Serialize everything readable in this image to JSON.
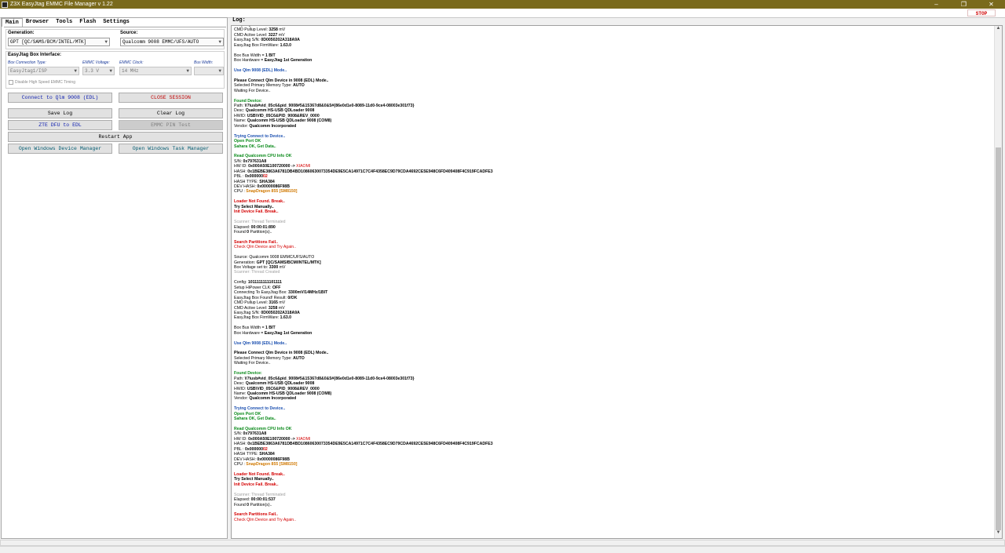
{
  "window": {
    "title": "Z3X EasyJtag EMMC File Manager v 1.22",
    "minimize": "–",
    "maximize": "❐",
    "close": "✕"
  },
  "toolbar": {
    "stop_label": "STOP"
  },
  "tabs": [
    {
      "label": "Main",
      "active": true
    },
    {
      "label": "Browser"
    },
    {
      "label": "Tools"
    },
    {
      "label": "Flash"
    },
    {
      "label": "Settings"
    }
  ],
  "main": {
    "generation_label": "Generation:",
    "generation_value": "GPT [QC/SAMS/BCM/INTEL/MTK]",
    "source_label": "Source:",
    "source_value": "Qualcomm 9008 EMMC/UFS/AUTO",
    "box_interface_label": "EasyJtag Box Interface:",
    "box_conn_type_label": "Box Connection Type:",
    "box_conn_type_value": "EasyJtag1/ISP",
    "emmc_voltage_label": "EMMC Voltage:",
    "emmc_voltage_value": "3.3 V",
    "emmc_clock_label": "EMMC Clock:",
    "emmc_clock_value": "14 MHz",
    "bus_width_label": "Bus Width:",
    "bus_width_value": "",
    "hs_timing_label": "Disable High Speed EMMC Timing",
    "buttons": {
      "connect": "Connect to Qlm 9008 (EDL)",
      "close_session": "CLOSE SESSION",
      "save_log": "Save Log",
      "clear_log": "Clear Log",
      "zte_dfu": "ZTE DFU to EDL",
      "emmc_pin_test": "EMMC PIN Test",
      "restart_app": "Restart App",
      "device_manager": "Open Windows Device Manager",
      "task_manager": "Open Windows Task Manager"
    }
  },
  "log": {
    "label": "Log:",
    "colors": {
      "black": "#000000",
      "blue": "#1a4fb0",
      "green": "#0a8a1a",
      "red": "#d40000",
      "orange": "#d07800",
      "gray": "#a0a0a0",
      "darkred": "#b00000"
    },
    "lines": [
      {
        "segs": [
          {
            "t": "EasyJtag Box Found! Result: "
          },
          {
            "t": "0/OK",
            "b": true
          }
        ],
        "c": "black"
      },
      {
        "segs": [
          {
            "t": " CMD Pullup Level: "
          },
          {
            "t": "3258",
            "b": true
          },
          {
            "t": " mV"
          }
        ],
        "c": "black"
      },
      {
        "segs": [
          {
            "t": " CMD Active Level: "
          },
          {
            "t": "3227",
            "b": true
          },
          {
            "t": " mV"
          }
        ],
        "c": "black"
      },
      {
        "segs": [
          {
            "t": "EasyJtag S/N: "
          },
          {
            "t": "0D0050202A318A9A",
            "b": true
          }
        ],
        "c": "black"
      },
      {
        "segs": [
          {
            "t": "EasyJtag Box FirmWare: "
          },
          {
            "t": "1.63.0",
            "b": true
          }
        ],
        "c": "black"
      },
      {
        "blank": true
      },
      {
        "segs": [
          {
            "t": "Box Bus Width = "
          },
          {
            "t": "1 BIT",
            "b": true
          }
        ],
        "c": "black"
      },
      {
        "segs": [
          {
            "t": "Box Hardware  = "
          },
          {
            "t": "EasyJtag 1st Generation",
            "b": true
          }
        ],
        "c": "black"
      },
      {
        "blank": true
      },
      {
        "segs": [
          {
            "t": "Use Qlm 9008 (EDL) Mode..",
            "b": true
          }
        ],
        "c": "blue"
      },
      {
        "blank": true
      },
      {
        "segs": [
          {
            "t": "Please Connect Qlm Device in 9008 (EDL) Mode..",
            "b": true
          }
        ],
        "c": "black"
      },
      {
        "segs": [
          {
            "t": " Selected Primary Memory Type: "
          },
          {
            "t": "AUTO",
            "b": true
          }
        ],
        "c": "black"
      },
      {
        "segs": [
          {
            "t": "Waiting For Device.."
          }
        ],
        "c": "black"
      },
      {
        "blank": true
      },
      {
        "segs": [
          {
            "t": "Found Device:",
            "b": true
          }
        ],
        "c": "green"
      },
      {
        "segs": [
          {
            "t": " Path: "
          },
          {
            "t": "\\\\?\\usb#vid_05c6&pid_9008#5&15367d8&0&5#{86e0d1e0-8089-11d0-9ce4-08003e301f73}",
            "b": true
          }
        ],
        "c": "black"
      },
      {
        "segs": [
          {
            "t": " Desc: "
          },
          {
            "t": "Qualcomm HS-USB QDLoader 9008",
            "b": true
          }
        ],
        "c": "black"
      },
      {
        "segs": [
          {
            "t": " HWID: "
          },
          {
            "t": "USB\\VID_05C6&PID_9008&REV_0000",
            "b": true
          }
        ],
        "c": "black"
      },
      {
        "segs": [
          {
            "t": " Name: "
          },
          {
            "t": "Qualcomm HS-USB QDLoader 9008 (COM8)",
            "b": true
          }
        ],
        "c": "black"
      },
      {
        "segs": [
          {
            "t": " Vendor: "
          },
          {
            "t": "Qualcomm Incorporated",
            "b": true
          }
        ],
        "c": "black"
      },
      {
        "blank": true
      },
      {
        "segs": [
          {
            "t": "Trying Connect to Device..",
            "b": true
          }
        ],
        "c": "blue"
      },
      {
        "segs": [
          {
            "t": "Open Port OK",
            "b": true
          }
        ],
        "c": "green"
      },
      {
        "segs": [
          {
            "t": "Sahara OK, Get Data..",
            "b": true
          }
        ],
        "c": "green"
      },
      {
        "blank": true
      },
      {
        "segs": [
          {
            "t": "Read Qualcomm CPU Info OK",
            "b": true
          }
        ],
        "c": "green"
      },
      {
        "segs": [
          {
            "t": " S/N: "
          },
          {
            "t": "0x797631A8",
            "b": true
          }
        ],
        "c": "black"
      },
      {
        "segs": [
          {
            "t": " HW ID: "
          },
          {
            "t": "0x000A50E100720000 -> ",
            "b": true
          },
          {
            "t": "XIAOMI",
            "c": "red"
          }
        ],
        "c": "black"
      },
      {
        "segs": [
          {
            "t": " HASH: "
          },
          {
            "t": "0x1BEBE3863A6781DB4BD10860630073354DE9E5CA14971C7C4F4358EC9D79CDA4692CE5E948C6FD409408F4C919FCADFE3",
            "b": true
          }
        ],
        "c": "black"
      },
      {
        "segs": [
          {
            "t": " PBL : "
          },
          {
            "t": "0x000000",
            "b": true
          },
          {
            "t": "02",
            "b": true,
            "c": "red"
          }
        ],
        "c": "black"
      },
      {
        "segs": [
          {
            "t": " HASH TYPE: "
          },
          {
            "t": "SHA384",
            "b": true
          }
        ],
        "c": "black"
      },
      {
        "segs": [
          {
            "t": " DEV HASH: "
          },
          {
            "t": "0x00000086F98B",
            "b": true
          }
        ],
        "c": "black"
      },
      {
        "segs": [
          {
            "t": " CPU : "
          },
          {
            "t": "SnapDragon 855 [SM8150]",
            "b": true,
            "c": "orange"
          }
        ],
        "c": "black"
      },
      {
        "blank": true
      },
      {
        "segs": [
          {
            "t": "Loader Not Found. Break..",
            "b": true
          }
        ],
        "c": "red"
      },
      {
        "segs": [
          {
            "t": "Try Select Manually..",
            "b": true
          }
        ],
        "c": "black"
      },
      {
        "segs": [
          {
            "t": "Init Device Fail. Break..",
            "b": true
          }
        ],
        "c": "red"
      },
      {
        "blank": true
      },
      {
        "segs": [
          {
            "t": "Scanner: Thread Terminated"
          }
        ],
        "c": "gray"
      },
      {
        "segs": [
          {
            "t": "Elapsed: "
          },
          {
            "t": "00:00:01:890",
            "b": true
          }
        ],
        "c": "black"
      },
      {
        "segs": [
          {
            "t": "Found "
          },
          {
            "t": "0",
            "b": true
          },
          {
            "t": " Partition(s).."
          }
        ],
        "c": "black"
      },
      {
        "blank": true
      },
      {
        "segs": [
          {
            "t": "Search Partitions Fail..",
            "b": true
          }
        ],
        "c": "red"
      },
      {
        "segs": [
          {
            "t": "Check Qlm Device and Try Again.."
          }
        ],
        "c": "red"
      },
      {
        "blank": true
      },
      {
        "segs": [
          {
            "t": "Source: Qualcomm 9008 EMMC/UFS/AUTO"
          }
        ],
        "c": "black"
      },
      {
        "segs": [
          {
            "t": "Generation: "
          },
          {
            "t": "GPT [QC/SAMS/BCM/INTEL/MTK]",
            "b": true
          }
        ],
        "c": "black"
      },
      {
        "segs": [
          {
            "t": "Box Voltage set to: "
          },
          {
            "t": "3300",
            "b": true
          },
          {
            "t": " mV"
          }
        ],
        "c": "black"
      },
      {
        "segs": [
          {
            "t": "Scanner: Thread Created"
          }
        ],
        "c": "gray"
      },
      {
        "blank": true
      },
      {
        "segs": [
          {
            "t": "Config: "
          },
          {
            "t": "1011111111101111",
            "b": true
          }
        ],
        "c": "black"
      },
      {
        "segs": [
          {
            "t": "Setup HiPower CLK: "
          },
          {
            "t": "OFF",
            "b": true
          }
        ],
        "c": "black"
      },
      {
        "segs": [
          {
            "t": "Connecting To EasyJtag Box: "
          },
          {
            "t": "3300mV/14MHz/1BIT",
            "b": true
          }
        ],
        "c": "black"
      },
      {
        "segs": [
          {
            "t": "EasyJtag Box Found! Result: "
          },
          {
            "t": "0/OK",
            "b": true
          }
        ],
        "c": "black"
      },
      {
        "segs": [
          {
            "t": " CMD Pullup Level: "
          },
          {
            "t": "3165",
            "b": true
          },
          {
            "t": " mV"
          }
        ],
        "c": "black"
      },
      {
        "segs": [
          {
            "t": " CMD Active Level: "
          },
          {
            "t": "3258",
            "b": true
          },
          {
            "t": " mV"
          }
        ],
        "c": "black"
      },
      {
        "segs": [
          {
            "t": "EasyJtag S/N: "
          },
          {
            "t": "0D0050202A318A9A",
            "b": true
          }
        ],
        "c": "black"
      },
      {
        "segs": [
          {
            "t": "EasyJtag Box FirmWare: "
          },
          {
            "t": "1.63.0",
            "b": true
          }
        ],
        "c": "black"
      },
      {
        "blank": true
      },
      {
        "segs": [
          {
            "t": "Box Bus Width = "
          },
          {
            "t": "1 BIT",
            "b": true
          }
        ],
        "c": "black"
      },
      {
        "segs": [
          {
            "t": "Box Hardware  = "
          },
          {
            "t": "EasyJtag 1st Generation",
            "b": true
          }
        ],
        "c": "black"
      },
      {
        "blank": true
      },
      {
        "segs": [
          {
            "t": "Use Qlm 9008 (EDL) Mode..",
            "b": true
          }
        ],
        "c": "blue"
      },
      {
        "blank": true
      },
      {
        "segs": [
          {
            "t": "Please Connect Qlm Device in 9008 (EDL) Mode..",
            "b": true
          }
        ],
        "c": "black"
      },
      {
        "segs": [
          {
            "t": " Selected Primary Memory Type: "
          },
          {
            "t": "AUTO",
            "b": true
          }
        ],
        "c": "black"
      },
      {
        "segs": [
          {
            "t": "Waiting For Device.."
          }
        ],
        "c": "black"
      },
      {
        "blank": true
      },
      {
        "segs": [
          {
            "t": "Found Device:",
            "b": true
          }
        ],
        "c": "green"
      },
      {
        "segs": [
          {
            "t": " Path: "
          },
          {
            "t": "\\\\?\\usb#vid_05c6&pid_9008#5&15367d8&0&5#{86e0d1e0-8089-11d0-9ce4-08003e301f73}",
            "b": true
          }
        ],
        "c": "black"
      },
      {
        "segs": [
          {
            "t": " Desc: "
          },
          {
            "t": "Qualcomm HS-USB QDLoader 9008",
            "b": true
          }
        ],
        "c": "black"
      },
      {
        "segs": [
          {
            "t": " HWID: "
          },
          {
            "t": "USB\\VID_05C6&PID_9008&REV_0000",
            "b": true
          }
        ],
        "c": "black"
      },
      {
        "segs": [
          {
            "t": " Name: "
          },
          {
            "t": "Qualcomm HS-USB QDLoader 9008 (COM8)",
            "b": true
          }
        ],
        "c": "black"
      },
      {
        "segs": [
          {
            "t": " Vendor: "
          },
          {
            "t": "Qualcomm Incorporated",
            "b": true
          }
        ],
        "c": "black"
      },
      {
        "blank": true
      },
      {
        "segs": [
          {
            "t": "Trying Connect to Device..",
            "b": true
          }
        ],
        "c": "blue"
      },
      {
        "segs": [
          {
            "t": "Open Port OK",
            "b": true
          }
        ],
        "c": "green"
      },
      {
        "segs": [
          {
            "t": "Sahara OK, Get Data..",
            "b": true
          }
        ],
        "c": "green"
      },
      {
        "blank": true
      },
      {
        "segs": [
          {
            "t": "Read Qualcomm CPU Info OK",
            "b": true
          }
        ],
        "c": "green"
      },
      {
        "segs": [
          {
            "t": " S/N: "
          },
          {
            "t": "0x797631A8",
            "b": true
          }
        ],
        "c": "black"
      },
      {
        "segs": [
          {
            "t": " HW ID: "
          },
          {
            "t": "0x000A50E100720000 -> ",
            "b": true
          },
          {
            "t": "XIAOMI",
            "c": "red"
          }
        ],
        "c": "black"
      },
      {
        "segs": [
          {
            "t": " HASH: "
          },
          {
            "t": "0x1BEBE3863A6781DB4BD10860630073354DE9E5CA14971C7C4F4358EC9D79CDA4692CE5E948C6FD409408F4C919FCADFE3",
            "b": true
          }
        ],
        "c": "black"
      },
      {
        "segs": [
          {
            "t": " PBL : "
          },
          {
            "t": "0x000000",
            "b": true
          },
          {
            "t": "02",
            "b": true,
            "c": "red"
          }
        ],
        "c": "black"
      },
      {
        "segs": [
          {
            "t": " HASH TYPE: "
          },
          {
            "t": "SHA384",
            "b": true
          }
        ],
        "c": "black"
      },
      {
        "segs": [
          {
            "t": " DEV HASH: "
          },
          {
            "t": "0x00000086F98B",
            "b": true
          }
        ],
        "c": "black"
      },
      {
        "segs": [
          {
            "t": " CPU : "
          },
          {
            "t": "SnapDragon 855 [SM8150]",
            "b": true,
            "c": "orange"
          }
        ],
        "c": "black"
      },
      {
        "blank": true
      },
      {
        "segs": [
          {
            "t": "Loader Not Found. Break..",
            "b": true
          }
        ],
        "c": "red"
      },
      {
        "segs": [
          {
            "t": "Try Select Manually..",
            "b": true
          }
        ],
        "c": "black"
      },
      {
        "segs": [
          {
            "t": "Init Device Fail. Break..",
            "b": true
          }
        ],
        "c": "red"
      },
      {
        "blank": true
      },
      {
        "segs": [
          {
            "t": "Scanner: Thread Terminated"
          }
        ],
        "c": "gray"
      },
      {
        "segs": [
          {
            "t": "Elapsed: "
          },
          {
            "t": "00:00:01:537",
            "b": true
          }
        ],
        "c": "black"
      },
      {
        "segs": [
          {
            "t": "Found "
          },
          {
            "t": "0",
            "b": true
          },
          {
            "t": " Partition(s).."
          }
        ],
        "c": "black"
      },
      {
        "blank": true
      },
      {
        "segs": [
          {
            "t": "Search Partitions Fail..",
            "b": true
          }
        ],
        "c": "red"
      },
      {
        "segs": [
          {
            "t": "Check Qlm Device and Try Again.."
          }
        ],
        "c": "red"
      }
    ]
  }
}
